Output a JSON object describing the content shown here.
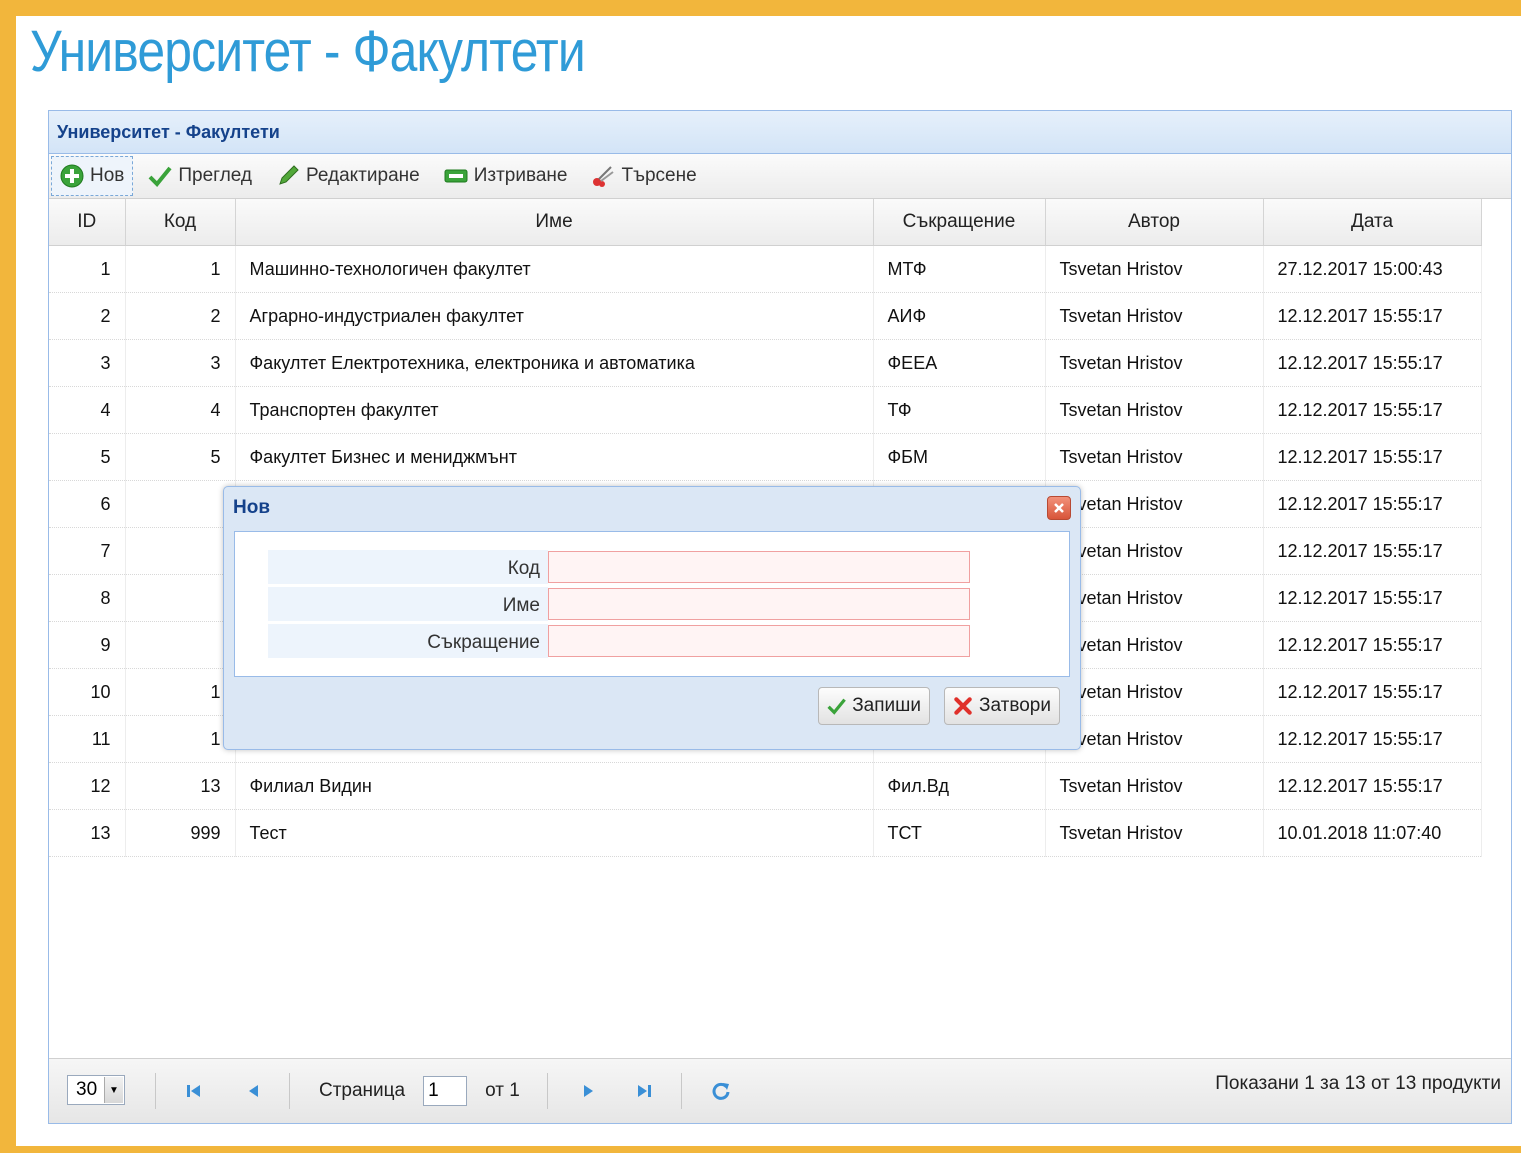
{
  "page": {
    "title": "Университет - Факултети"
  },
  "panel": {
    "title": "Университет - Факултети",
    "toolbar": {
      "new": "Нов",
      "view": "Преглед",
      "edit": "Редактиране",
      "delete": "Изтриване",
      "search": "Търсене"
    },
    "columns": [
      "ID",
      "Код",
      "Име",
      "Съкращение",
      "Автор",
      "Дата"
    ],
    "rows": [
      {
        "id": "1",
        "code": "1",
        "name": "Машинно-технологичен факултет",
        "abbr": "МТФ",
        "author": "Tsvetan Hristov",
        "date": "27.12.2017 15:00:43"
      },
      {
        "id": "2",
        "code": "2",
        "name": "Аграрно-индустриален факултет",
        "abbr": "АИФ",
        "author": "Tsvetan Hristov",
        "date": "12.12.2017 15:55:17"
      },
      {
        "id": "3",
        "code": "3",
        "name": "Факултет Електротехника, електроника и автоматика",
        "abbr": "ФЕЕА",
        "author": "Tsvetan Hristov",
        "date": "12.12.2017 15:55:17"
      },
      {
        "id": "4",
        "code": "4",
        "name": "Транспортен факултет",
        "abbr": "ТФ",
        "author": "Tsvetan Hristov",
        "date": "12.12.2017 15:55:17"
      },
      {
        "id": "5",
        "code": "5",
        "name": "Факултет Бизнес и мениджмънт",
        "abbr": "ФБМ",
        "author": "Tsvetan Hristov",
        "date": "12.12.2017 15:55:17"
      },
      {
        "id": "6",
        "code": "",
        "name": "",
        "abbr": "",
        "author": "Tsvetan Hristov",
        "date": "12.12.2017 15:55:17"
      },
      {
        "id": "7",
        "code": "",
        "name": "",
        "abbr": "",
        "author": "Tsvetan Hristov",
        "date": "12.12.2017 15:55:17"
      },
      {
        "id": "8",
        "code": "",
        "name": "",
        "abbr": "",
        "author": "Tsvetan Hristov",
        "date": "12.12.2017 15:55:17"
      },
      {
        "id": "9",
        "code": "",
        "name": "",
        "abbr": "",
        "author": "Tsvetan Hristov",
        "date": "12.12.2017 15:55:17"
      },
      {
        "id": "10",
        "code": "1",
        "name": "",
        "abbr": "",
        "author": "Tsvetan Hristov",
        "date": "12.12.2017 15:55:17"
      },
      {
        "id": "11",
        "code": "1",
        "name": "",
        "abbr": "",
        "author": "Tsvetan Hristov",
        "date": "12.12.2017 15:55:17"
      },
      {
        "id": "12",
        "code": "13",
        "name": "Филиал Видин",
        "abbr": "Фил.Вд",
        "author": "Tsvetan Hristov",
        "date": "12.12.2017 15:55:17"
      },
      {
        "id": "13",
        "code": "999",
        "name": "Тест",
        "abbr": "ТСТ",
        "author": "Tsvetan Hristov",
        "date": "10.01.2018 11:07:40"
      }
    ],
    "pager": {
      "page_size": "30",
      "page_label": "Страница",
      "page_value": "1",
      "of_label": "от 1",
      "summary": "Показани 1 за 13 от 13 продукти"
    }
  },
  "dialog": {
    "title": "Нов",
    "fields": [
      {
        "label": "Код",
        "value": ""
      },
      {
        "label": "Име",
        "value": ""
      },
      {
        "label": "Съкращение",
        "value": ""
      }
    ],
    "save_label": "Запиши",
    "close_label": "Затвори"
  },
  "colors": {
    "outer_background": "#f2b63c",
    "title_blue": "#2f9bd7",
    "panel_border": "#99bbe8",
    "header_text": "#15428b",
    "required_field_border": "#f0a0a0"
  },
  "icons": {
    "new": "plus-circle-icon",
    "view": "checkmark-icon",
    "edit": "pencil-icon",
    "delete": "minus-icon",
    "search": "scissors-icon",
    "close": "close-icon",
    "save": "checkmark-icon",
    "cancel": "x-icon"
  }
}
